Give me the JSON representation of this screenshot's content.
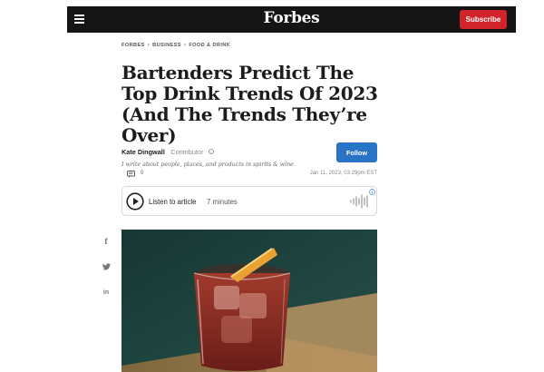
{
  "header": {
    "logo": "Forbes",
    "subscribe_label": "Subscribe",
    "menu_icon": "hamburger-icon"
  },
  "breadcrumb": [
    "FORBES",
    "BUSINESS",
    "FOOD & DRINK"
  ],
  "article": {
    "title": "Bartenders Predict The Top Drink Trends Of 2023 (And The Trends They’re Over)",
    "author": "Kate Dingwall",
    "author_role": "Contributor",
    "author_bio": "I write about people, places, and products in spirits & wine.",
    "follow_label": "Follow",
    "comment_count": "0",
    "date": "Jan 11, 2023, 03:29pm EST"
  },
  "audio": {
    "label": "Listen to article",
    "duration": "7 minutes",
    "icons": [
      "play-icon",
      "soundwave-icon",
      "info-icon"
    ]
  },
  "share_icons": [
    "facebook-icon",
    "twitter-icon",
    "linkedin-icon"
  ],
  "colors": {
    "topbar": "#151515",
    "subscribe": "#d1232a",
    "follow": "#2a74c8"
  }
}
